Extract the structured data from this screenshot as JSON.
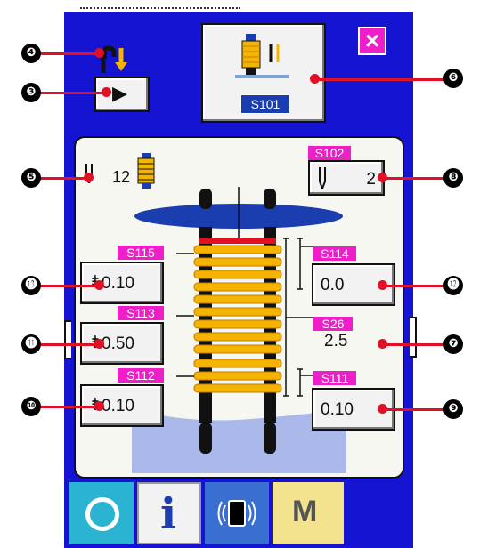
{
  "top": {
    "main_button_label": "S101",
    "close_label": "×",
    "arrow_label": "▶"
  },
  "thread": {
    "count": "12"
  },
  "s102": {
    "tag": "S102",
    "value": "2"
  },
  "s115": {
    "tag": "S115",
    "value": "0.10"
  },
  "s114": {
    "tag": "S114",
    "value": "0.0"
  },
  "s113": {
    "tag": "S113",
    "value": "0.50"
  },
  "s26": {
    "tag": "S26",
    "value": "2.5"
  },
  "s112": {
    "tag": "S112",
    "value": "0.10"
  },
  "s111": {
    "tag": "S111",
    "value": "0.10"
  },
  "callouts": [
    "❹",
    "❸",
    "❺",
    "❻",
    "❽",
    "⓭",
    "⓬",
    "⓫",
    "❼",
    "❿",
    "❾"
  ],
  "bottom": {
    "info_label": "i",
    "menu_label": "M"
  }
}
